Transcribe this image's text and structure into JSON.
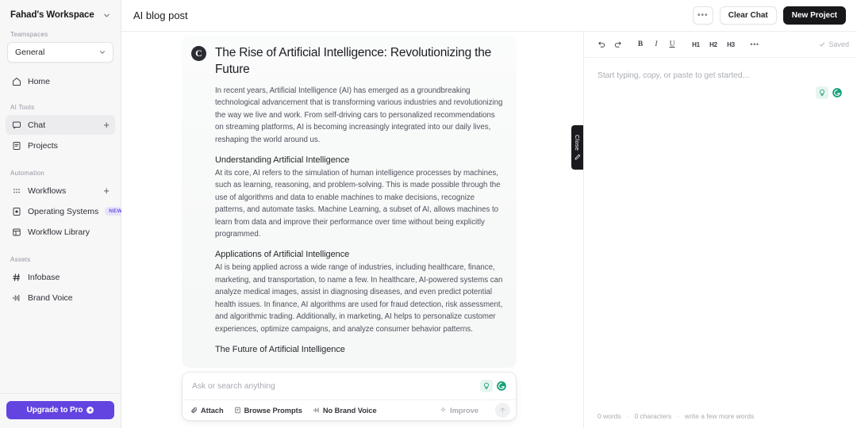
{
  "sidebar": {
    "workspace_name": "Fahad's Workspace",
    "sections": {
      "teamspaces_label": "Teamspaces",
      "ai_tools_label": "AI Tools",
      "automation_label": "Automation",
      "assets_label": "Assets"
    },
    "teamspace_selected": "General",
    "items": [
      {
        "label": "Home",
        "icon": "home-icon",
        "group": "top",
        "add": false,
        "badge": ""
      },
      {
        "label": "Chat",
        "icon": "chat-bubble-icon",
        "group": "ai_tools",
        "add": true,
        "badge": "",
        "active": true
      },
      {
        "label": "Projects",
        "icon": "document-icon",
        "group": "ai_tools",
        "add": false,
        "badge": ""
      },
      {
        "label": "Workflows",
        "icon": "workflows-grid-icon",
        "group": "automation",
        "add": true,
        "badge": ""
      },
      {
        "label": "Operating Systems",
        "icon": "operating-systems-icon",
        "group": "automation",
        "add": false,
        "badge": "NEW"
      },
      {
        "label": "Workflow Library",
        "icon": "library-icon",
        "group": "automation",
        "add": false,
        "badge": ""
      },
      {
        "label": "Infobase",
        "icon": "hash-icon",
        "group": "assets",
        "add": false,
        "badge": ""
      },
      {
        "label": "Brand Voice",
        "icon": "waveform-icon",
        "group": "assets",
        "add": false,
        "badge": ""
      }
    ],
    "upgrade_label": "Upgrade to Pro",
    "accent_purple": "#6344e0",
    "badge_bg": "#e6e2fb",
    "badge_fg": "#6d55e0"
  },
  "topbar": {
    "title": "AI blog post",
    "more_label": "•••",
    "clear_chat_label": "Clear Chat",
    "new_project_label": "New Project"
  },
  "message": {
    "avatar_letter": "C",
    "title": "The Rise of Artificial Intelligence: Revolutionizing the Future",
    "intro": "In recent years, Artificial Intelligence (AI) has emerged as a groundbreaking technological advancement that is transforming various industries and revolutionizing the way we live and work. From self-driving cars to personalized recommendations on streaming platforms, AI is becoming increasingly integrated into our daily lives, reshaping the world around us.",
    "section1_heading": "Understanding Artificial Intelligence",
    "section1_body": "At its core, AI refers to the simulation of human intelligence processes by machines, such as learning, reasoning, and problem-solving. This is made possible through the use of algorithms and data to enable machines to make decisions, recognize patterns, and automate tasks. Machine Learning, a subset of AI, allows machines to learn from data and improve their performance over time without being explicitly programmed.",
    "section2_heading": "Applications of Artificial Intelligence",
    "section2_body": "AI is being applied across a wide range of industries, including healthcare, finance, marketing, and transportation, to name a few. In healthcare, AI-powered systems can analyze medical images, assist in diagnosing diseases, and even predict potential health issues. In finance, AI algorithms are used for fraud detection, risk assessment, and algorithmic trading. Additionally, in marketing, AI helps to personalize customer experiences, optimize campaigns, and analyze consumer behavior patterns.",
    "section3_heading": "The Future of Artificial Intelligence"
  },
  "composer": {
    "placeholder": "Ask or search anything",
    "value": "",
    "attach_label": "Attach",
    "browse_prompts_label": "Browse Prompts",
    "brand_voice_label": "No Brand Voice",
    "improve_label": "Improve",
    "accent_green": "#17a07a"
  },
  "close_tab": {
    "label": "Close",
    "icon": "pencil-icon"
  },
  "editor": {
    "toolbar": {
      "undo": "undo-icon",
      "redo": "redo-icon",
      "bold": "B",
      "italic": "I",
      "underline": "U",
      "h1": "H1",
      "h2": "H2",
      "h3": "H3",
      "more": "•••",
      "saved_label": "Saved"
    },
    "placeholder": "Start typing, copy, or paste to get started...",
    "content": "",
    "status": {
      "words": "0 words",
      "characters": "0 characters",
      "hint": "write a few more words",
      "sep": "·"
    }
  }
}
